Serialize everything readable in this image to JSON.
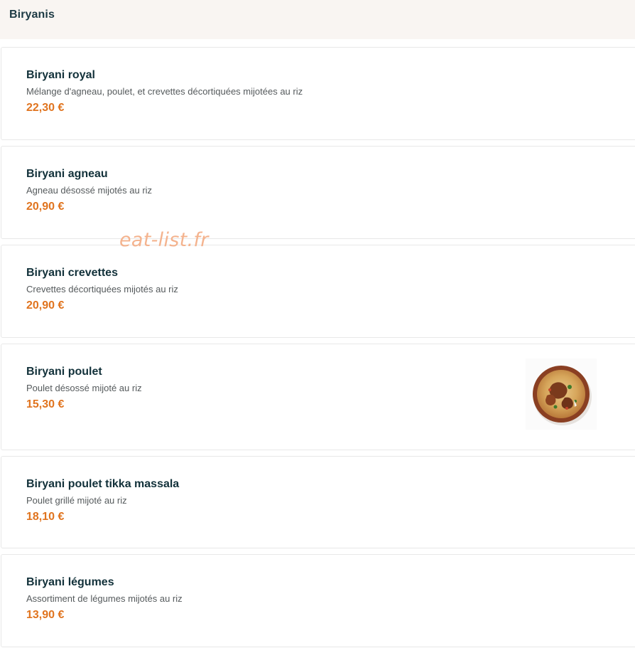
{
  "section": {
    "title": "Biryanis"
  },
  "items": [
    {
      "name": "Biryani royal",
      "description": "Mélange d'agneau, poulet, et crevettes décortiquées mijotées au riz",
      "price": "22,30 €"
    },
    {
      "name": "Biryani agneau",
      "description": "Agneau désossé mijotés au riz",
      "price": "20,90 €"
    },
    {
      "name": "Biryani crevettes",
      "description": "Crevettes décortiquées mijotés au riz",
      "price": "20,90 €"
    },
    {
      "name": "Biryani poulet",
      "description": "Poulet désossé mijoté au riz",
      "price": "15,30 €",
      "image": "biryani-dish-photo"
    },
    {
      "name": "Biryani poulet tikka massala",
      "description": "Poulet grillé mijoté au riz",
      "price": "18,10 €"
    },
    {
      "name": "Biryani légumes",
      "description": "Assortiment de légumes mijotés au riz",
      "price": "13,90 €"
    }
  ],
  "watermark": "eat-list.fr",
  "colors": {
    "header_bg": "#f9f5f2",
    "title": "#12313a",
    "price": "#e0741f",
    "watermark": "#f4b38e"
  }
}
